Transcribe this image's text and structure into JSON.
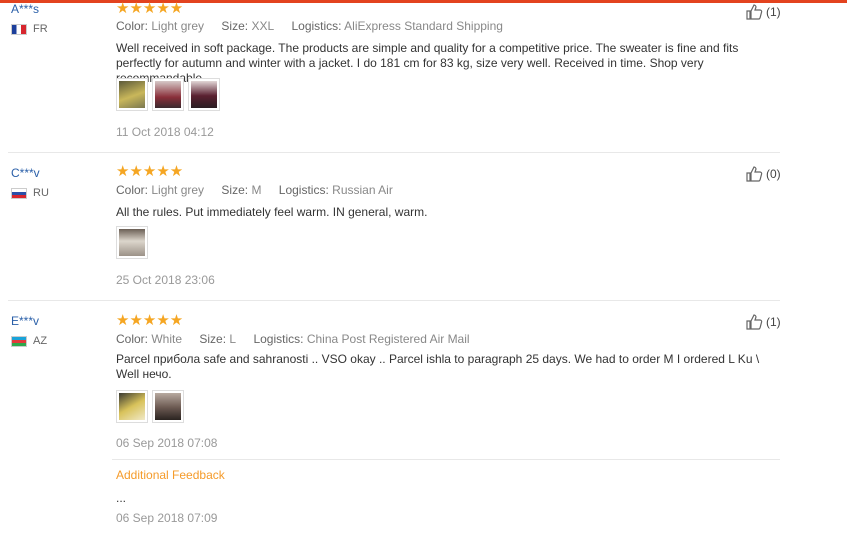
{
  "labels": {
    "color": "Color:",
    "size": "Size:",
    "logistics": "Logistics:"
  },
  "reviews": [
    {
      "user": "A***s",
      "country": "FR",
      "stars": "★★★★★",
      "color": "Light grey",
      "size": "XXL",
      "logistics": "AliExpress Standard Shipping",
      "text": "Well received in soft package. The products are simple and quality for a competitive price. The sweater is fine and fits perfectly for autumn and winter with a jacket. I do 181 cm for 83 kg, size very well. Received in time. Shop very recommandable.",
      "date": "11 Oct 2018 04:12",
      "helpful": "(1)"
    },
    {
      "user": "C***v",
      "country": "RU",
      "stars": "★★★★★",
      "color": "Light grey",
      "size": "M",
      "logistics": "Russian Air",
      "text": "All the rules. Put immediately feel warm. IN general, warm.",
      "date": "25 Oct 2018 23:06",
      "helpful": "(0)"
    },
    {
      "user": "E***v",
      "country": "AZ",
      "stars": "★★★★★",
      "color": "White",
      "size": "L",
      "logistics": "China Post Registered Air Mail",
      "text": "Parcel прибола safe and sahranosti .. VSO okay .. Parcel ishla to paragraph 25 days. We had to order M I ordered L Ku \\ Well нечо.",
      "date": "06 Sep 2018 07:08",
      "helpful": "(1)",
      "additional_title": "Additional Feedback",
      "additional_text": "...",
      "additional_date": "06 Sep 2018 07:09"
    }
  ],
  "colors": {
    "accent": "#e3431f",
    "star": "#f5a623",
    "username": "#2a5fa8",
    "additional": "#f59b2a"
  },
  "icons": {
    "helpful": "thumbs-up-icon"
  }
}
